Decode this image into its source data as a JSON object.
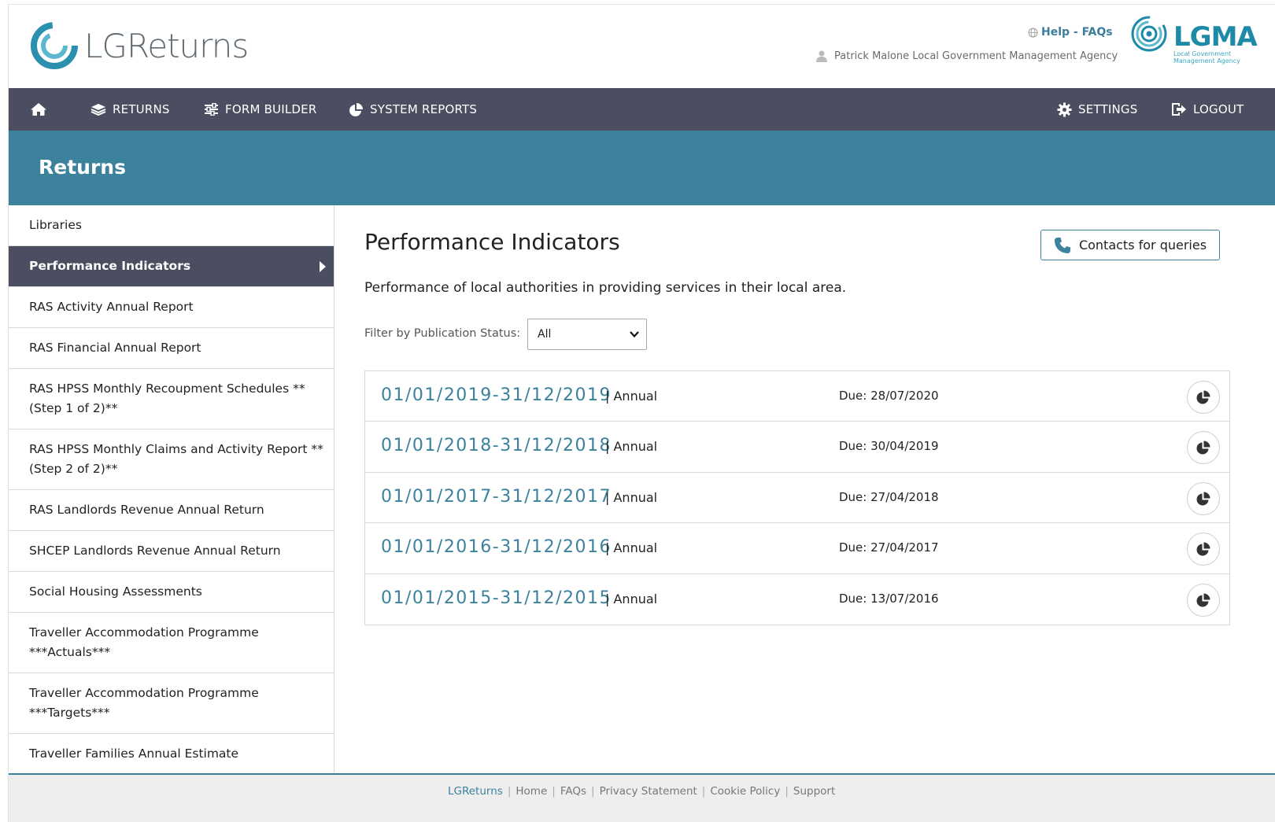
{
  "header": {
    "logo_text": "LGReturns",
    "help_label": "Help - FAQs",
    "user_text": "Patrick Malone Local Government Management Agency",
    "partner_logo_text": "LGMA",
    "partner_logo_sub_line1": "Local Government",
    "partner_logo_sub_line2": "Management Agency"
  },
  "nav": {
    "returns": "RETURNS",
    "form_builder": "FORM BUILDER",
    "system_reports": "SYSTEM REPORTS",
    "settings": "SETTINGS",
    "logout": "LOGOUT"
  },
  "banner": {
    "title": "Returns"
  },
  "sidebar": {
    "items": [
      {
        "label": "Libraries"
      },
      {
        "label": "Performance Indicators"
      },
      {
        "label": "RAS Activity Annual Report"
      },
      {
        "label": "RAS Financial Annual Report"
      },
      {
        "label": "RAS HPSS Monthly Recoupment Schedules ** (Step 1 of 2)**"
      },
      {
        "label": "RAS HPSS Monthly Claims and Activity Report ** (Step 2 of 2)**"
      },
      {
        "label": "RAS Landlords Revenue Annual Return"
      },
      {
        "label": "SHCEP Landlords Revenue Annual Return"
      },
      {
        "label": "Social Housing Assessments"
      },
      {
        "label": "Traveller Accommodation Programme ***Actuals***"
      },
      {
        "label": "Traveller Accommodation Programme ***Targets***"
      },
      {
        "label": "Traveller Families Annual Estimate"
      }
    ]
  },
  "main": {
    "title": "Performance Indicators",
    "contacts_label": "Contacts for queries",
    "description": "Performance of local authorities in providing services in their local area.",
    "filter_label": "Filter by Publication Status:",
    "filter_value": "All",
    "returns": [
      {
        "period": "01/01/2019-31/12/2019",
        "type": "| Annual",
        "due": "Due: 28/07/2020"
      },
      {
        "period": "01/01/2018-31/12/2018",
        "type": "| Annual",
        "due": "Due: 30/04/2019"
      },
      {
        "period": "01/01/2017-31/12/2017",
        "type": "| Annual",
        "due": "Due: 27/04/2018"
      },
      {
        "period": "01/01/2016-31/12/2016",
        "type": "| Annual",
        "due": "Due: 27/04/2017"
      },
      {
        "period": "01/01/2015-31/12/2015",
        "type": "| Annual",
        "due": "Due: 13/07/2016"
      }
    ]
  },
  "footer": {
    "links": [
      "LGReturns",
      "Home",
      "FAQs",
      "Privacy Statement",
      "Cookie Policy",
      "Support"
    ]
  },
  "colors": {
    "nav_bg": "#4b4e60",
    "banner_bg": "#3c829c",
    "accent": "#3c829c"
  }
}
